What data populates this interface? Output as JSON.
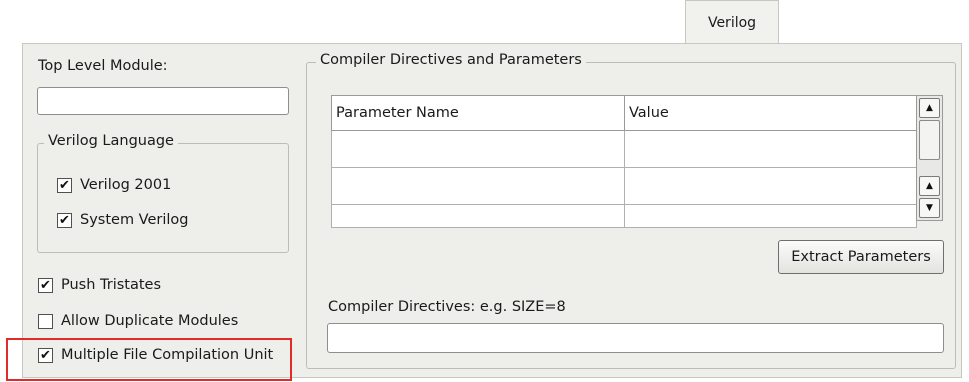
{
  "tab": {
    "label": "Verilog"
  },
  "top_level_module": {
    "label": "Top Level Module:",
    "value": ""
  },
  "verilog_language": {
    "title": "Verilog Language",
    "options": [
      {
        "label": "Verilog 2001",
        "checked": true
      },
      {
        "label": "System Verilog",
        "checked": true
      }
    ]
  },
  "options": [
    {
      "label": "Push Tristates",
      "checked": true
    },
    {
      "label": "Allow Duplicate Modules",
      "checked": false
    },
    {
      "label": "Multiple File Compilation Unit",
      "checked": true
    }
  ],
  "compiler_section": {
    "title": "Compiler Directives and Parameters",
    "table": {
      "columns": [
        "Parameter Name",
        "Value"
      ],
      "rows": [
        [
          "",
          ""
        ],
        [
          "",
          ""
        ],
        [
          "",
          ""
        ]
      ]
    },
    "extract_button": "Extract Parameters",
    "directives_label": "Compiler Directives: e.g. SIZE=8",
    "directives_value": ""
  },
  "icons": {
    "check": "✔",
    "up": "▲",
    "down": "▼"
  },
  "colors": {
    "highlight": "#e02b2b",
    "panel": "#eeeeeb"
  }
}
